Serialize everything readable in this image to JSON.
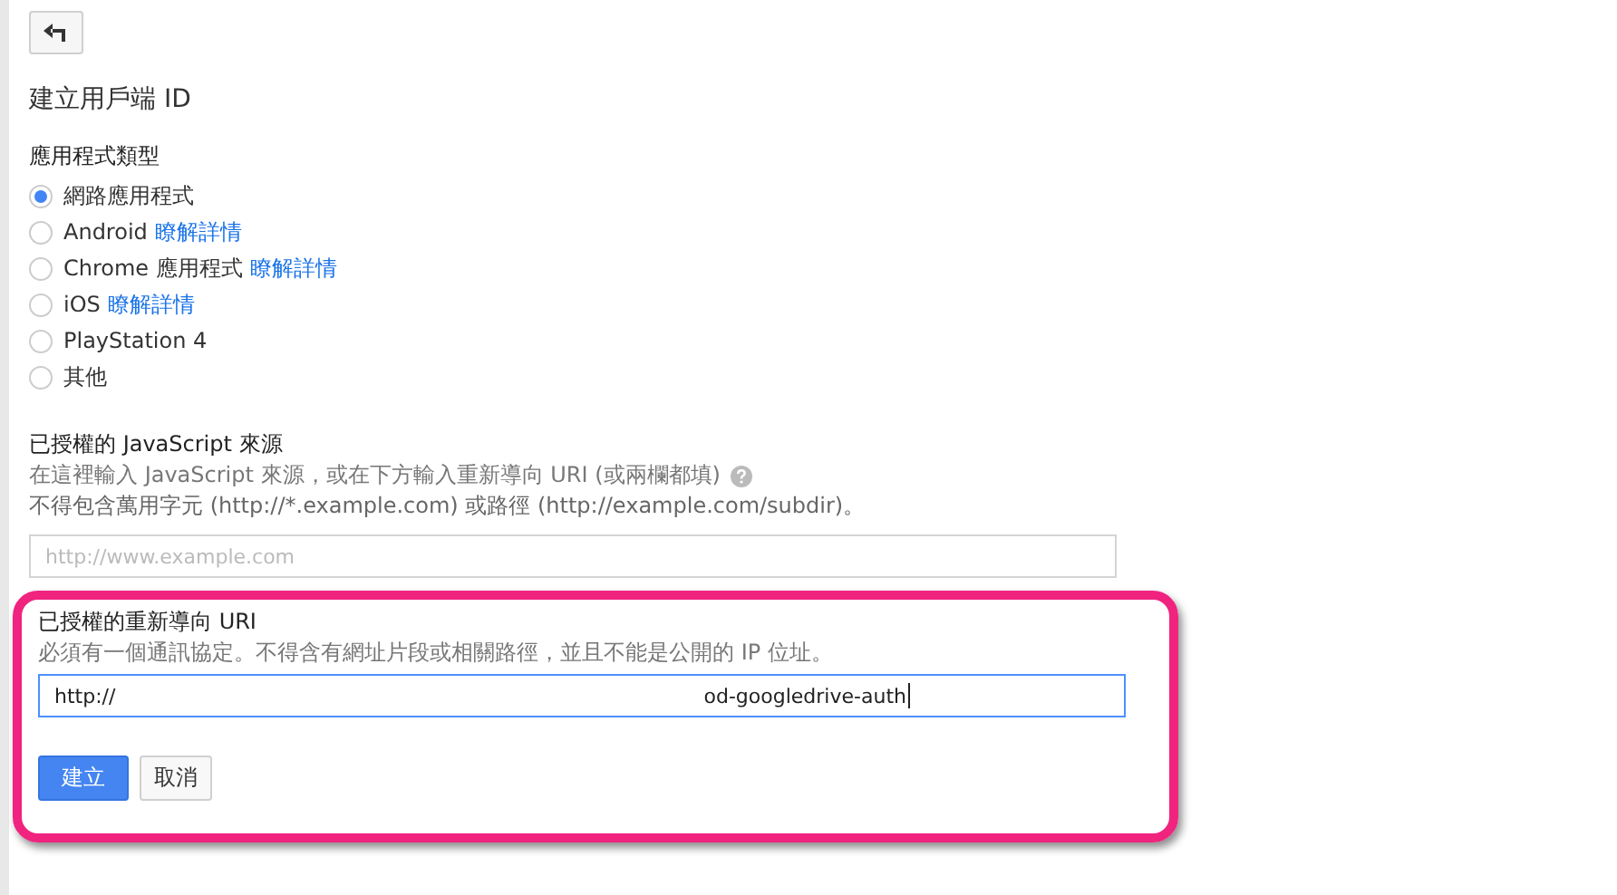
{
  "back_button": {
    "kind": "back"
  },
  "title": "建立用戶端 ID",
  "application_type": {
    "label": "應用程式類型",
    "options": [
      {
        "label": "網路應用程式",
        "selected": true
      },
      {
        "label": "Android",
        "link": "瞭解詳情",
        "selected": false
      },
      {
        "label": "Chrome 應用程式",
        "link": "瞭解詳情",
        "selected": false
      },
      {
        "label": "iOS",
        "link": "瞭解詳情",
        "selected": false
      },
      {
        "label": "PlayStation 4",
        "selected": false
      },
      {
        "label": "其他",
        "selected": false
      }
    ]
  },
  "javascript_origins": {
    "label": "已授權的 JavaScript 來源",
    "hint": "在這裡輸入 JavaScript 來源，或在下方輸入重新導向 URI (或兩欄都填)",
    "help_icon": true,
    "note": "不得包含萬用字元 (http://*.example.com) 或路徑 (http://example.com/subdir)。",
    "placeholder": "http://www.example.com"
  },
  "redirect_uris": {
    "label": "已授權的重新導向 URI",
    "hint": "必須有一個通訊協定。不得含有網址片段或相關路徑，並且不能是公開的 IP 位址。",
    "value_parts": [
      "http://",
      "od-googledrive-auth"
    ],
    "focused": true,
    "highlighted": true
  },
  "buttons": [
    {
      "label": "建立",
      "kind": "primary"
    },
    {
      "label": "取消",
      "kind": "secondary"
    }
  ]
}
